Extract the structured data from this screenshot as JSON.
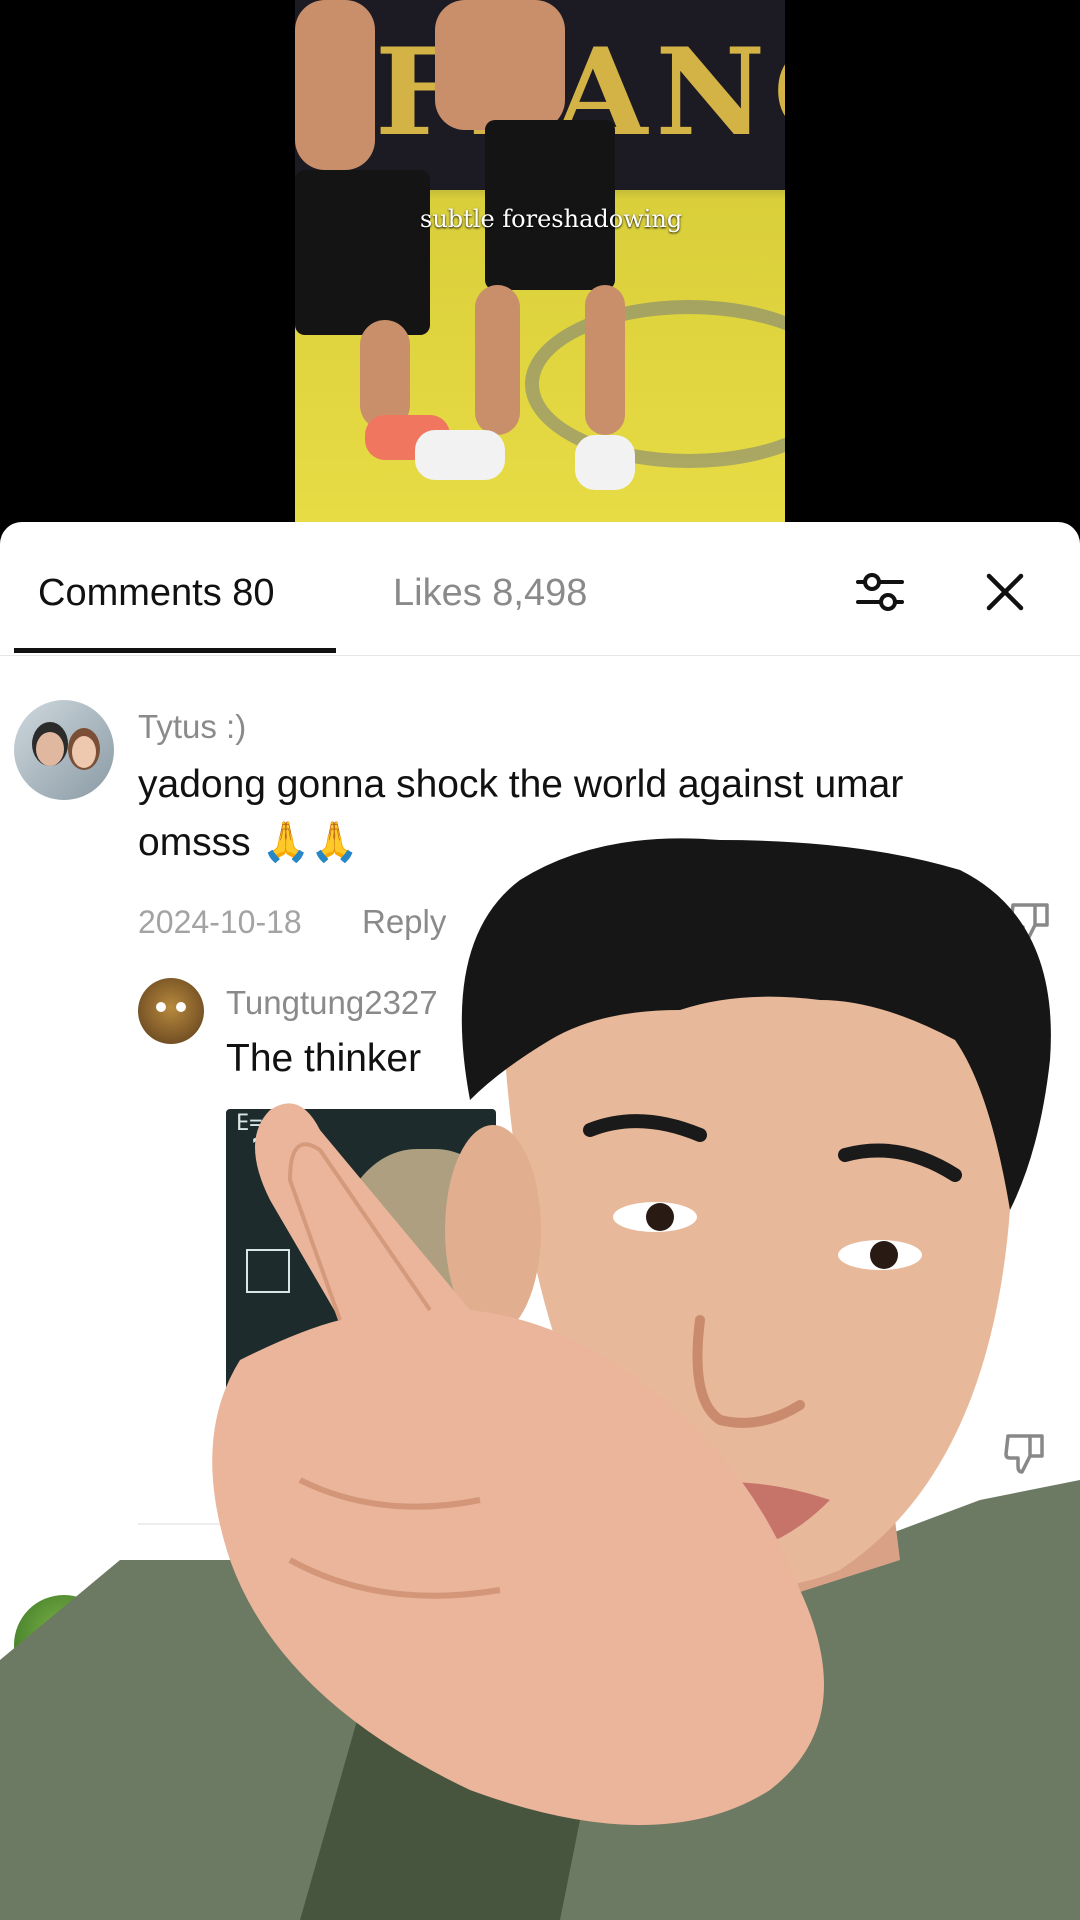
{
  "video": {
    "caption": "subtle foreshadowing",
    "banner_text": "FFANC"
  },
  "tabs": {
    "comments_label": "Comments 80",
    "likes_label": "Likes 8,498"
  },
  "comments": [
    {
      "username": "Tytus :)",
      "text_line1": "yadong gonna shock the world against umar",
      "text_line2": "omsss 🙏🙏",
      "date": "2024-10-18",
      "reply_label": "Reply"
    }
  ],
  "reply": {
    "username": "Tungtung2327",
    "text": "The thinker",
    "image_formula": "E=mc²",
    "image_qmark": "?"
  },
  "colors": {
    "sheet_bg": "#ffffff",
    "text_primary": "#111111",
    "text_secondary": "#8a8a8a",
    "skin": "#e8b89a",
    "shirt": "#6c7a63"
  },
  "icons": [
    "filter-icon",
    "close-icon",
    "dislike-icon"
  ]
}
